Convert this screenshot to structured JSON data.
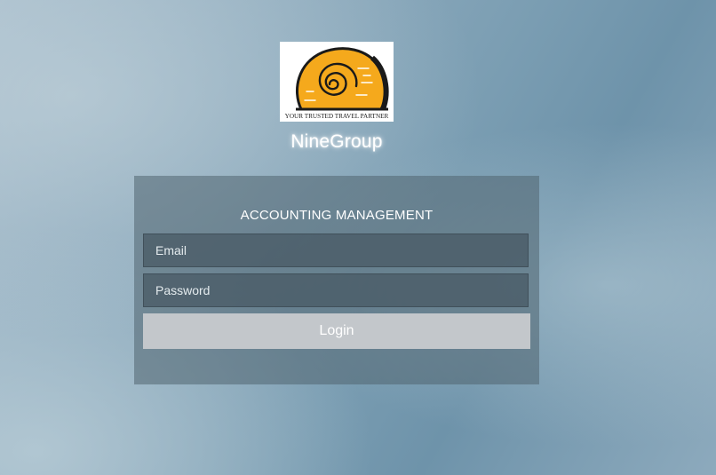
{
  "logo": {
    "tagline": "YOUR TRUSTED TRAVEL PARTNER",
    "colors": {
      "shell": "#f5a91c",
      "outline": "#1a1a1a"
    }
  },
  "brand": {
    "name": "NineGroup"
  },
  "login": {
    "title": "ACCOUNTING MANAGEMENT",
    "email_placeholder": "Email",
    "password_placeholder": "Password",
    "button_label": "Login"
  }
}
